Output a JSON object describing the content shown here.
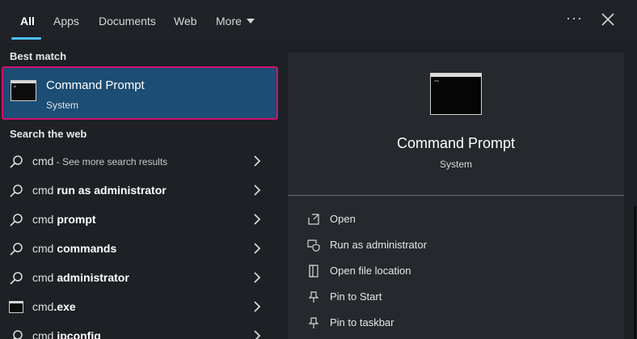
{
  "tabs": {
    "all": "All",
    "apps": "Apps",
    "documents": "Documents",
    "web": "Web",
    "more": "More"
  },
  "window_controls": {
    "ellipsis": "···"
  },
  "best_match": {
    "heading": "Best match",
    "title": "Command Prompt",
    "subtitle": "System"
  },
  "search_web": {
    "heading": "Search the web",
    "items": [
      {
        "prefix": "cmd",
        "bold": "",
        "hint": " - See more search results",
        "icon": "search-icon"
      },
      {
        "prefix": "cmd ",
        "bold": "run as administrator",
        "hint": "",
        "icon": "search-icon"
      },
      {
        "prefix": "cmd ",
        "bold": "prompt",
        "hint": "",
        "icon": "search-icon"
      },
      {
        "prefix": "cmd ",
        "bold": "commands",
        "hint": "",
        "icon": "search-icon"
      },
      {
        "prefix": "cmd ",
        "bold": "administrator",
        "hint": "",
        "icon": "search-icon"
      },
      {
        "prefix": "cmd",
        "bold": ".exe",
        "hint": "",
        "icon": "terminal-icon"
      },
      {
        "prefix": "cmd ",
        "bold": "ipconfig",
        "hint": "",
        "icon": "search-icon"
      }
    ]
  },
  "preview": {
    "title": "Command Prompt",
    "subtitle": "System",
    "actions": [
      {
        "label": "Open",
        "icon": "open-icon"
      },
      {
        "label": "Run as administrator",
        "icon": "shield-icon"
      },
      {
        "label": "Open file location",
        "icon": "file-location-icon"
      },
      {
        "label": "Pin to Start",
        "icon": "pin-icon"
      },
      {
        "label": "Pin to taskbar",
        "icon": "pin-icon"
      }
    ]
  },
  "colors": {
    "accent": "#4cc2ff",
    "highlight_bg": "#1c4d74",
    "highlight_border": "#d1106e"
  }
}
